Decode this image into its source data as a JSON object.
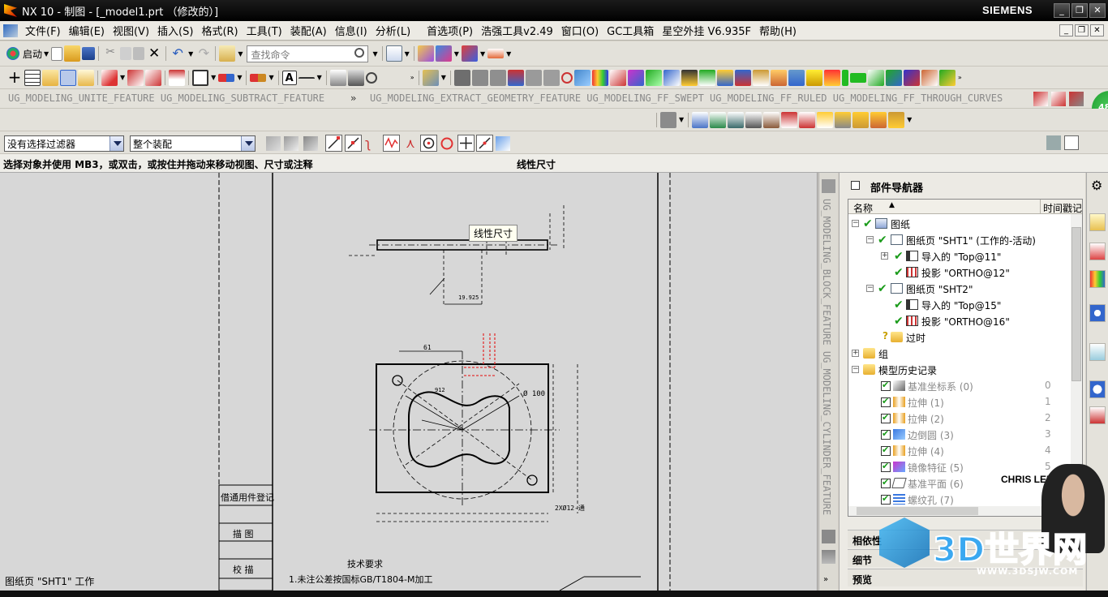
{
  "titlebar": {
    "title": "NX 10 - 制图 - [_model1.prt （修改的）]",
    "brand": "SIEMENS",
    "min": "_",
    "restore": "❐",
    "close": "✕"
  },
  "menu": {
    "items": [
      "文件(F)",
      "编辑(E)",
      "视图(V)",
      "插入(S)",
      "格式(R)",
      "工具(T)",
      "装配(A)",
      "信息(I)",
      "分析(L)",
      "首选项(P)",
      "浩强工具v2.49",
      "窗口(O)",
      "GC工具箱",
      "星空外挂 V6.935F",
      "帮助(H)"
    ]
  },
  "toolbar1": {
    "start_label": "启动",
    "search_placeholder": "查找命令"
  },
  "ugstrip": {
    "left": "UG_MODELING_UNITE_FEATURE  UG_MODELING_SUBTRACT_FEATURE",
    "right": "UG_MODELING_EXTRACT_GEOMETRY_FEATURE  UG_MODELING_FF_SWEPT  UG_MODELING_FF_RULED  UG_MODELING_FF_THROUGH_CURVES",
    "badge": "48"
  },
  "selection": {
    "filter": "没有选择过滤器",
    "scope": "整个装配"
  },
  "cue": {
    "prompt": "选择对象并使用 MB3，或双击，或按住并拖动来移动视图、尺寸或注释",
    "status": "线性尺寸"
  },
  "canvas": {
    "tooltip": "线性尺寸",
    "status": "图纸页 \"SHT1\" 工作",
    "table_labels": [
      "借通用件登记",
      "描  图",
      "校  描"
    ],
    "tech_title": "技术要求",
    "tech_note": "1.未注公差按国标GB/T1804-M加工",
    "dims": {
      "d100": "Ø 100",
      "d912": "912",
      "d925": "19.925",
      "d61": "61",
      "d2x": "2XØ12-通"
    }
  },
  "vstrip": {
    "text": "UG_MODELING_BLOCK_FEATURE  UG_MODELING_CYLINDER_FEATURE"
  },
  "navigator": {
    "title": "部件导航器",
    "col_name": "名称",
    "col_time": "时间戳记",
    "nodes": [
      {
        "label": "图纸"
      },
      {
        "label": "图纸页 \"SHT1\" (工作的-活动)"
      },
      {
        "label": "导入的 \"Top@11\""
      },
      {
        "label": "投影 \"ORTHO@12\""
      },
      {
        "label": "图纸页 \"SHT2\""
      },
      {
        "label": "导入的 \"Top@15\""
      },
      {
        "label": "投影 \"ORTHO@16\""
      },
      {
        "label": "过时"
      },
      {
        "label": "组"
      },
      {
        "label": "模型历史记录"
      }
    ],
    "history": [
      {
        "label": "基准坐标系 (0)",
        "num": "0"
      },
      {
        "label": "拉伸 (1)",
        "num": "1"
      },
      {
        "label": "拉伸 (2)",
        "num": "2"
      },
      {
        "label": "边倒圆 (3)",
        "num": "3"
      },
      {
        "label": "拉伸 (4)",
        "num": "4"
      },
      {
        "label": "镜像特征 (5)",
        "num": "5"
      },
      {
        "label": "基准平面 (6)",
        "num": "6"
      },
      {
        "label": "螺纹孔 (7)",
        "num": ""
      }
    ],
    "panels": [
      "相依性",
      "细节",
      "预览"
    ]
  },
  "watermark": {
    "name": "CHRIS LEE",
    "site": "3D世界网",
    "url": "WWW.3DSJW.COM"
  },
  "colors": {
    "check": "#1a9b1a",
    "sketch_red": "#e23232",
    "accent_blue": "#2c68c0"
  }
}
